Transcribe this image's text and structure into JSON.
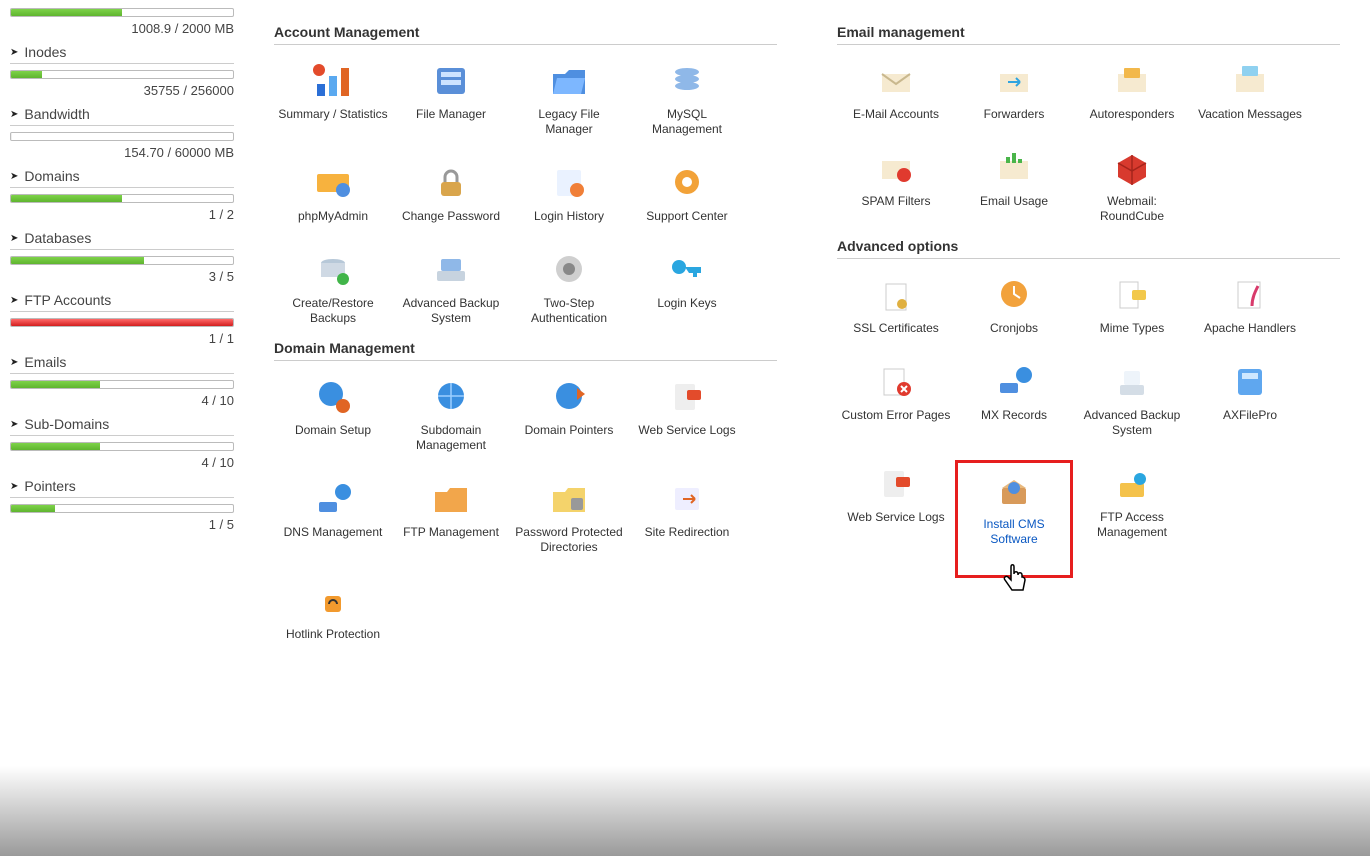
{
  "sidebar": {
    "items": [
      {
        "label": "",
        "value": "1008.9 / 2000 MB",
        "fill_pct": 50,
        "color": "green",
        "show_label": false
      },
      {
        "label": "Inodes",
        "value": "35755 / 256000",
        "fill_pct": 14,
        "color": "green",
        "show_label": true
      },
      {
        "label": "Bandwidth",
        "value": "154.70 / 60000 MB",
        "fill_pct": 0.3,
        "color": "gray",
        "show_label": true
      },
      {
        "label": "Domains",
        "value": "1 / 2",
        "fill_pct": 50,
        "color": "green",
        "show_label": true
      },
      {
        "label": "Databases",
        "value": "3 / 5",
        "fill_pct": 60,
        "color": "green",
        "show_label": true
      },
      {
        "label": "FTP Accounts",
        "value": "1 / 1",
        "fill_pct": 100,
        "color": "red",
        "show_label": true
      },
      {
        "label": "Emails",
        "value": "4 / 10",
        "fill_pct": 40,
        "color": "green",
        "show_label": true
      },
      {
        "label": "Sub-Domains",
        "value": "4 / 10",
        "fill_pct": 40,
        "color": "green",
        "show_label": true
      },
      {
        "label": "Pointers",
        "value": "1 / 5",
        "fill_pct": 20,
        "color": "green",
        "show_label": true
      }
    ]
  },
  "sections": {
    "account": {
      "title": "Account Management",
      "items": [
        {
          "label": "Summary / Statistics",
          "icon": "stats"
        },
        {
          "label": "File Manager",
          "icon": "drawer"
        },
        {
          "label": "Legacy File Manager",
          "icon": "folder-open"
        },
        {
          "label": "MySQL Management",
          "icon": "database"
        },
        {
          "label": "phpMyAdmin",
          "icon": "php"
        },
        {
          "label": "Change Password",
          "icon": "lock"
        },
        {
          "label": "Login History",
          "icon": "history"
        },
        {
          "label": "Support Center",
          "icon": "support"
        },
        {
          "label": "Create/Restore Backups",
          "icon": "backup"
        },
        {
          "label": "Advanced Backup System",
          "icon": "backup2"
        },
        {
          "label": "Two-Step Authentication",
          "icon": "twostep"
        },
        {
          "label": "Login Keys",
          "icon": "key"
        }
      ]
    },
    "domain": {
      "title": "Domain Management",
      "items": [
        {
          "label": "Domain Setup",
          "icon": "globe-gear"
        },
        {
          "label": "Subdomain Management",
          "icon": "globe-sub"
        },
        {
          "label": "Domain Pointers",
          "icon": "globe-point"
        },
        {
          "label": "Web Service Logs",
          "icon": "logs"
        },
        {
          "label": "DNS Management",
          "icon": "dns"
        },
        {
          "label": "FTP Management",
          "icon": "folder-ftp"
        },
        {
          "label": "Password Protected Directories",
          "icon": "folder-lock"
        },
        {
          "label": "Site Redirection",
          "icon": "redirect"
        },
        {
          "label": "Hotlink Protection",
          "icon": "hotlink"
        }
      ]
    },
    "email": {
      "title": "Email management",
      "items": [
        {
          "label": "E-Mail Accounts",
          "icon": "mail"
        },
        {
          "label": "Forwarders",
          "icon": "mail-fwd"
        },
        {
          "label": "Autoresponders",
          "icon": "mail-auto"
        },
        {
          "label": "Vacation Messages",
          "icon": "mail-vac"
        },
        {
          "label": "SPAM Filters",
          "icon": "mail-spam"
        },
        {
          "label": "Email Usage",
          "icon": "mail-usage"
        },
        {
          "label": "Webmail: RoundCube",
          "icon": "mail-cube"
        }
      ]
    },
    "advanced": {
      "title": "Advanced options",
      "items": [
        {
          "label": "SSL Certificates",
          "icon": "ssl"
        },
        {
          "label": "Cronjobs",
          "icon": "cron"
        },
        {
          "label": "Mime Types",
          "icon": "mime"
        },
        {
          "label": "Apache Handlers",
          "icon": "apache"
        },
        {
          "label": "Custom Error Pages",
          "icon": "error"
        },
        {
          "label": "MX Records",
          "icon": "mx"
        },
        {
          "label": "Advanced Backup System",
          "icon": "backup3"
        },
        {
          "label": "AXFilePro",
          "icon": "axfile"
        },
        {
          "label": "Web Service Logs",
          "icon": "logs2"
        },
        {
          "label": "Install CMS Software",
          "icon": "cms",
          "highlighted": true
        },
        {
          "label": "FTP Access Management",
          "icon": "ftp-access"
        }
      ]
    }
  }
}
